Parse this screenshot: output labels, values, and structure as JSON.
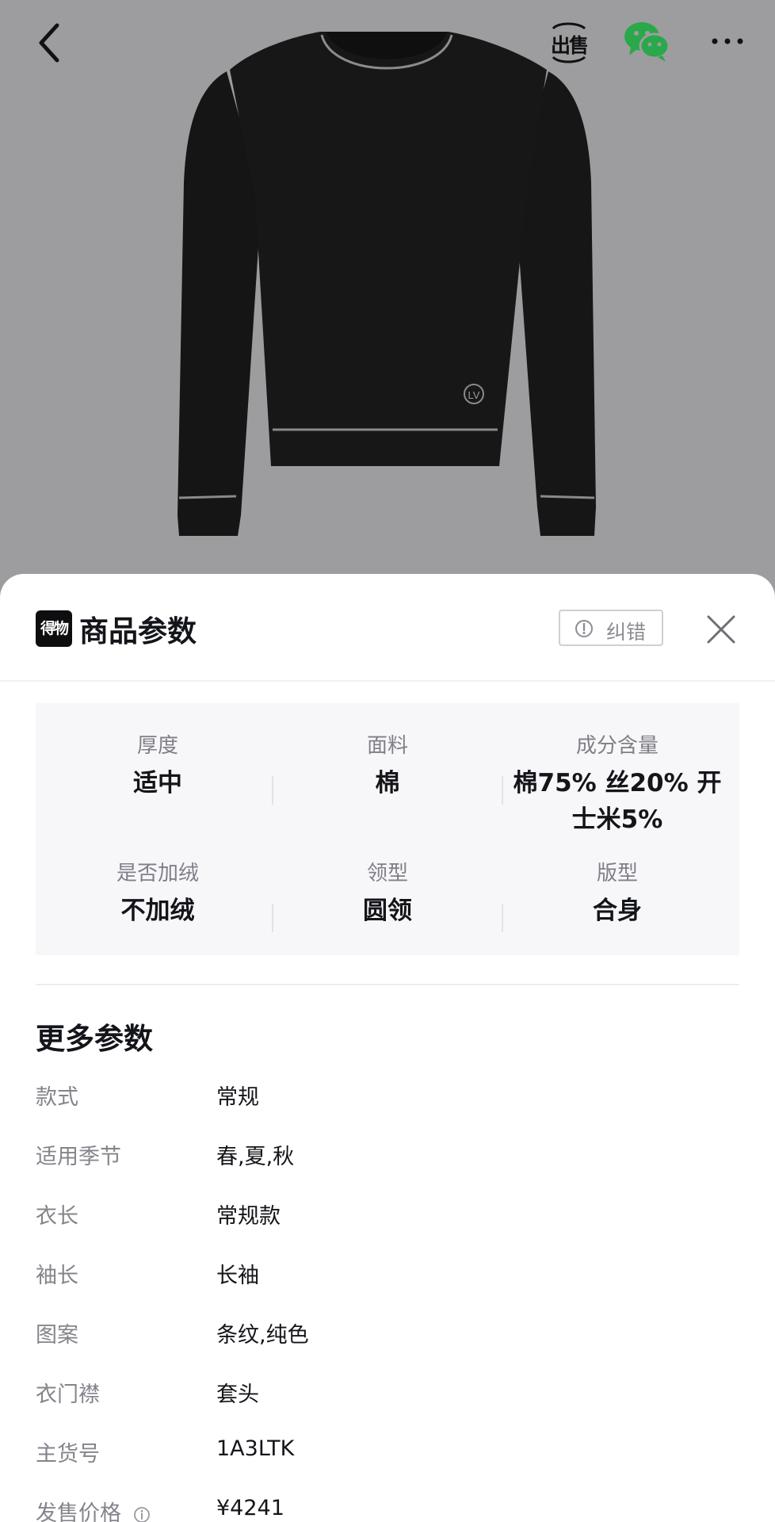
{
  "topbar": {
    "sell_label": "出售"
  },
  "sheet": {
    "brand_logo_text": "得物",
    "title": "商品参数",
    "report_label": "纠错"
  },
  "params": [
    {
      "key": "厚度",
      "value": "适中"
    },
    {
      "key": "面料",
      "value": "棉"
    },
    {
      "key": "成分含量",
      "value_line1": "棉75% 丝20% 开",
      "value_line2": "士米5%"
    },
    {
      "key": "是否加绒",
      "value": "不加绒"
    },
    {
      "key": "领型",
      "value": "圆领"
    },
    {
      "key": "版型",
      "value": "合身"
    }
  ],
  "more": {
    "title": "更多参数",
    "rows": [
      {
        "key": "款式",
        "value": "常规"
      },
      {
        "key": "适用季节",
        "value": "春,夏,秋"
      },
      {
        "key": "衣长",
        "value": "常规款"
      },
      {
        "key": "袖长",
        "value": "长袖"
      },
      {
        "key": "图案",
        "value": "条纹,纯色"
      },
      {
        "key": "衣门襟",
        "value": "套头"
      },
      {
        "key": "主货号",
        "value": "1A3LTK"
      },
      {
        "key": "发售价格",
        "value": "¥4241"
      }
    ]
  },
  "colors": {
    "background": "#9d9d9f",
    "sweater": "#151515",
    "wechat_green": "#2aa84a"
  }
}
